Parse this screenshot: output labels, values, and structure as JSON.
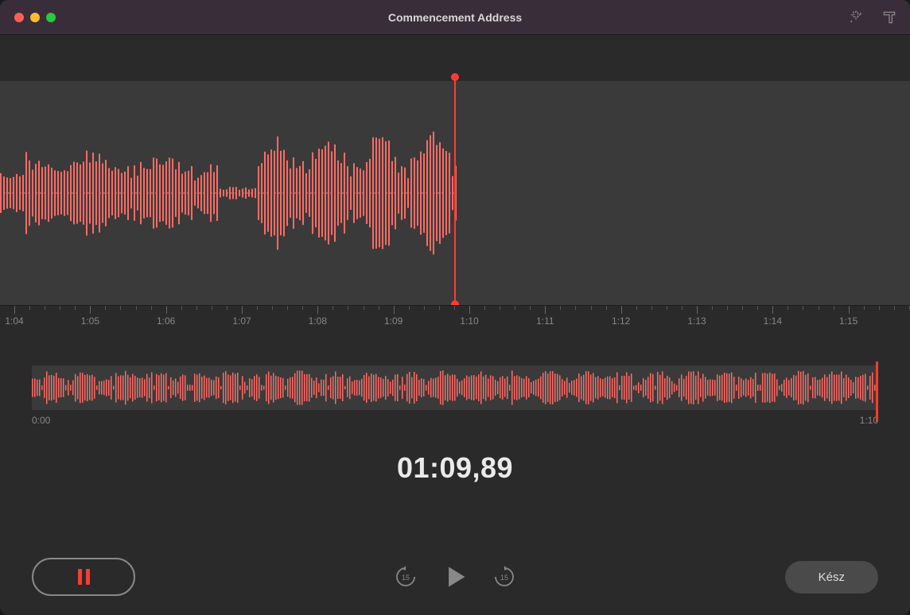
{
  "window": {
    "title": "Commencement Address"
  },
  "colors": {
    "accent": "#ff3b30",
    "background": "#2a2a2a",
    "waveform_bg": "#3a3a3a"
  },
  "timeline": {
    "ticks": [
      "1:04",
      "1:05",
      "1:06",
      "1:07",
      "1:08",
      "1:09",
      "1:10",
      "1:11",
      "1:12",
      "1:13",
      "1:14",
      "1:15"
    ]
  },
  "overview": {
    "start_label": "0:00",
    "end_label": "1:10"
  },
  "playback": {
    "current_time": "01:09,89",
    "skip_seconds": "15"
  },
  "buttons": {
    "done_label": "Kész"
  }
}
